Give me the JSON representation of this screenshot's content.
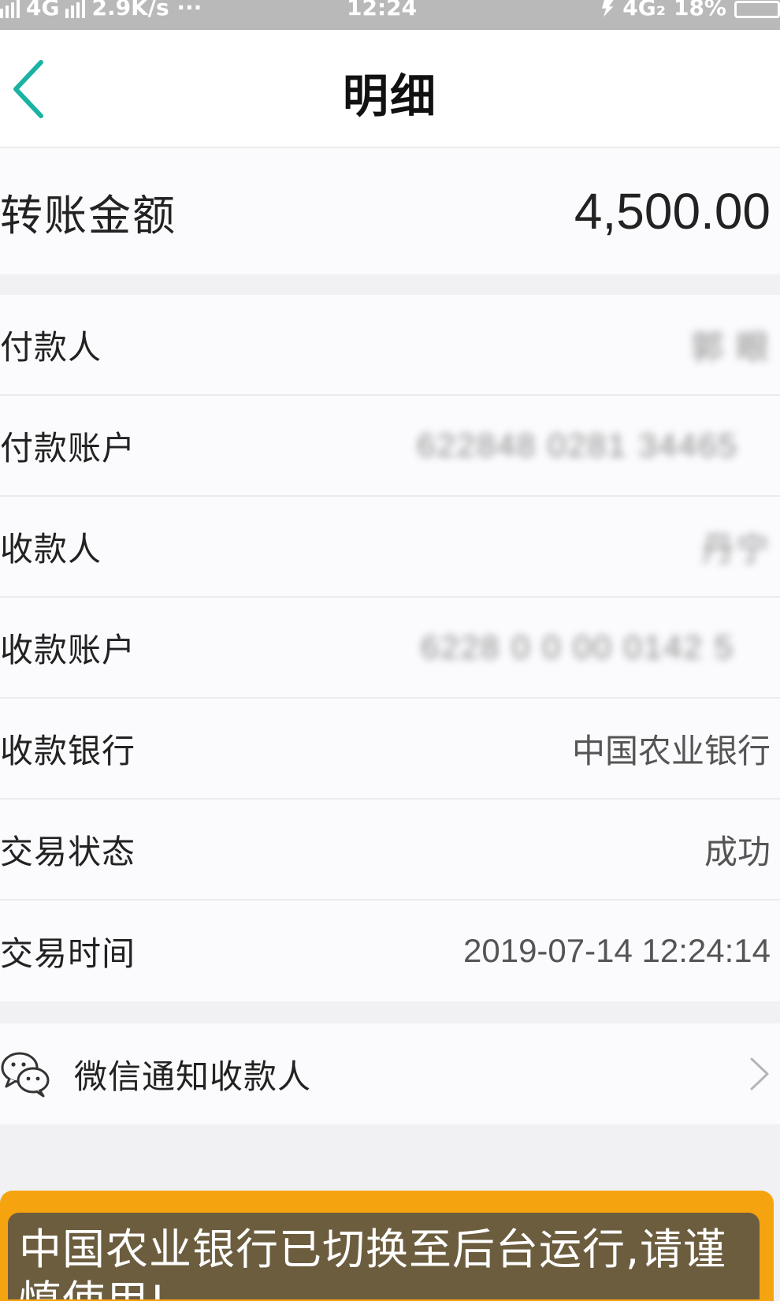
{
  "status_bar": {
    "network": "4G",
    "speed": "2.9K/s ···",
    "time": "12:24",
    "right_icons": "4G₂",
    "battery": "18%"
  },
  "nav": {
    "title": "明细",
    "back_icon": "chevron-left-icon"
  },
  "colors": {
    "accent": "#1ab3a3",
    "toast_border": "#f5a30f",
    "toast_bg": "#6c5d3f",
    "background": "#f1f1f3"
  },
  "amount": {
    "label": "转账金额",
    "value": "4,500.00"
  },
  "details": [
    {
      "label": "付款人",
      "value": "郭 眼"
    },
    {
      "label": "付款账户",
      "value": "622848 0281 34465"
    },
    {
      "label": "收款人",
      "value": "丹宁"
    },
    {
      "label": "收款账户",
      "value": "6228 0 0 00 0142 5"
    },
    {
      "label": "收款银行",
      "value": "中国农业银行"
    },
    {
      "label": "交易状态",
      "value": "成功"
    },
    {
      "label": "交易时间",
      "value": "2019-07-14 12:24:14"
    }
  ],
  "wechat_notify": {
    "label": "微信通知收款人",
    "icon": "wechat-icon"
  },
  "toast": {
    "text": "中国农业银行已切换至后台运行,请谨慎使用!"
  }
}
